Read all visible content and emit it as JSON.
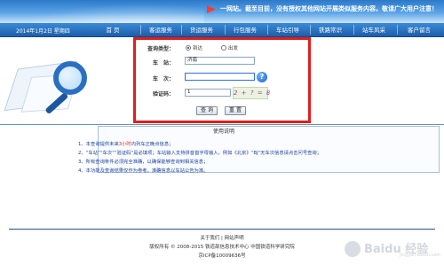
{
  "banner": {
    "notice": "一网站。截至目前，没有授权其他网站开展类似服务内容。敬请广大用户注意！"
  },
  "nav": {
    "date": "2014年1月2日 星期四",
    "items": [
      "首  页",
      "客运服务",
      "货运服务",
      "行包服务",
      "车站引导",
      "铁路常识",
      "站车风采",
      "客户留言"
    ]
  },
  "query": {
    "type_label": "查询类型：",
    "options": [
      "到达",
      "出发"
    ],
    "selected_option": "到达",
    "station_label": "车　站：",
    "station_value": "济南",
    "train_label": "车　次：",
    "train_value": "",
    "captcha_label": "验证码：",
    "captcha_value": "1",
    "captcha_image_text": "2 + ? = 8",
    "submit_label": "查 询",
    "reset_label": "重 置"
  },
  "instructions": {
    "title": "使用说明",
    "items": [
      {
        "num": "1、",
        "before": "本查询提供未来",
        "highlight": "3小时",
        "after": "内列车正晚点信息；"
      },
      {
        "num": "2、",
        "before": "“车站”“车次”“验证码”是必填项；车站输入支持拼音首字母输入，例如《北京》“BJ”无车次信息请点击问号查询；",
        "highlight": "",
        "after": ""
      },
      {
        "num": "3、",
        "before": "所有查询条件必须完全准确，以确保能够查询到相关信息；",
        "highlight": "",
        "after": ""
      },
      {
        "num": "4、",
        "before": "本功能及查询结果仅作为参考，准确信息以车站公告为准。",
        "highlight": "",
        "after": ""
      }
    ]
  },
  "footer": {
    "links": "关于我们 | 网站声明",
    "copyright": "版权所有 © 2008-2015 铁道部信息技术中心 中国铁道科学研究院",
    "icp": "京ICP备10009636号"
  },
  "watermark": {
    "brand": "Baidu 经验",
    "url": "jingyan.baidu.com"
  },
  "colors": {
    "highlight_frame": "#e11d1d",
    "nav_bg": "#1d5fab",
    "instruction_text": "#1b3f9c"
  }
}
